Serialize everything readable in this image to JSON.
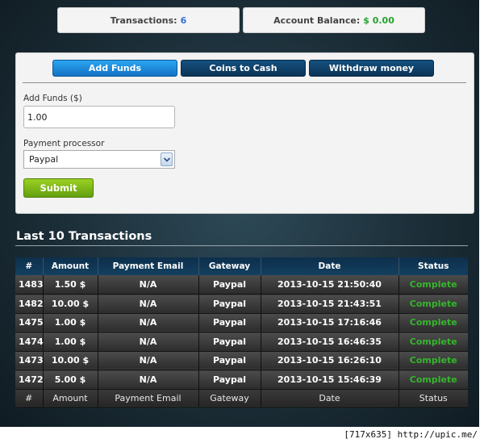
{
  "stats": {
    "transactions_label": "Transactions:",
    "transactions_value": "6",
    "balance_label": "Account Balance:",
    "balance_value": "$ 0.00"
  },
  "tabs": [
    "Add Funds",
    "Coins to Cash",
    "Withdraw money"
  ],
  "form": {
    "amount_label": "Add Funds ($)",
    "amount_value": "1.00",
    "processor_label": "Payment processor",
    "processor_value": "Paypal",
    "submit_label": "Submit"
  },
  "transactions": {
    "title": "Last 10 Transactions",
    "columns": [
      "#",
      "Amount",
      "Payment Email",
      "Gateway",
      "Date",
      "Status"
    ],
    "rows": [
      [
        "1483",
        "1.50 $",
        "N/A",
        "Paypal",
        "2013-10-15 21:50:40",
        "Complete"
      ],
      [
        "1482",
        "10.00 $",
        "N/A",
        "Paypal",
        "2013-10-15 21:43:51",
        "Complete"
      ],
      [
        "1475",
        "1.00 $",
        "N/A",
        "Paypal",
        "2013-10-15 17:16:46",
        "Complete"
      ],
      [
        "1474",
        "1.00 $",
        "N/A",
        "Paypal",
        "2013-10-15 16:46:35",
        "Complete"
      ],
      [
        "1473",
        "10.00 $",
        "N/A",
        "Paypal",
        "2013-10-15 16:26:10",
        "Complete"
      ],
      [
        "1472",
        "5.00 $",
        "N/A",
        "Paypal",
        "2013-10-15 15:46:39",
        "Complete"
      ]
    ]
  },
  "watermark": "[717x635] http://upic.me/",
  "colors": {
    "accent_blue": "#1a82d6",
    "dark_navy": "#0c3457",
    "status_green": "#35b52c",
    "submit_green": "#7fbf18"
  },
  "icons": {
    "select_arrow": "chevron-down-icon"
  }
}
